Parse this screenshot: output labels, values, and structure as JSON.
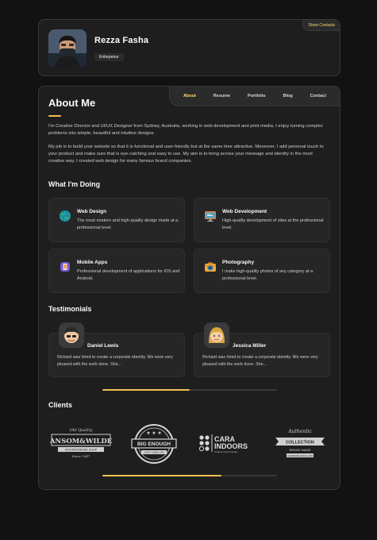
{
  "profile": {
    "name": "Rezza Fasha",
    "role": "Entrepenur",
    "show_contacts": "Show Contacts"
  },
  "nav": [
    {
      "label": "About",
      "active": true
    },
    {
      "label": "Resume",
      "active": false
    },
    {
      "label": "Portfolio",
      "active": false
    },
    {
      "label": "Blog",
      "active": false
    },
    {
      "label": "Contact",
      "active": false
    }
  ],
  "about": {
    "title": "About Me",
    "paragraph1": "I'm Creative Director and UI/UX Designer from Sydney, Australia, working in web development and print media. I enjoy turning complex problems into simple, beautiful and intuitive designs.",
    "paragraph2": "My job is to build your website so that it is functional and user-friendly but at the same time attractive. Moreover, I add personal touch to your product and make sure that is eye-catching and easy to use. My aim is to bring across your message and identity in the most creative way. I created web design for many famous brand companies."
  },
  "doing": {
    "title": "What I'm Doing",
    "items": [
      {
        "title": "Web Design",
        "text": "The most modern and high-quality design made at a professional level.",
        "icon": "globe-icon"
      },
      {
        "title": "Web Development",
        "text": "High-quality development of sites at the professional level.",
        "icon": "monitor-icon"
      },
      {
        "title": "Mobile Apps",
        "text": "Professional development of applications for iOS and Android.",
        "icon": "mobile-app-icon"
      },
      {
        "title": "Photography",
        "text": "I make high-quality photos of any category at a professional level.",
        "icon": "camera-icon"
      }
    ]
  },
  "testimonials": {
    "title": "Testimonials",
    "items": [
      {
        "name": "Daniel Lewis",
        "text": "Richard was hired to create a corporate identity. We were very pleased with the work done. She..."
      },
      {
        "name": "Jessica Miller",
        "text": "Richard was hired to create a corporate identity. We were very pleased with the work done. She..."
      }
    ],
    "scroll_progress": 0.5
  },
  "clients": {
    "title": "Clients",
    "logos": [
      {
        "top": "Old Quality",
        "main": "RANSOM&WILDER",
        "sub": "WOODWORKING SHOP",
        "foot": "Since 1947"
      },
      {
        "main": "BIG ENOUGH",
        "sub": "LOVE YOUR LIFE"
      },
      {
        "main": "CARA",
        "main2": "INDOORS",
        "sub": "Unique Interior Design"
      },
      {
        "top": "Authentic",
        "main": "COLLECTION",
        "sub": "BRAND NAME",
        "foot": "HANDMADE SINCE 1995"
      }
    ],
    "scroll_progress": 0.68
  },
  "colors": {
    "accent": "#ffdb70",
    "accent_bar": "#f2c14e",
    "card": "#1e1e1f",
    "background": "#121212"
  }
}
